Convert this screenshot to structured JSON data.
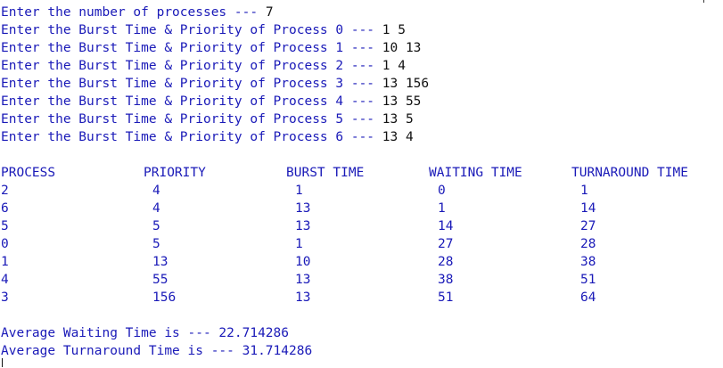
{
  "input_lines": [
    {
      "prompt": "Enter the number of processes --- ",
      "value": "7"
    },
    {
      "prompt": "Enter the Burst Time & Priority of Process 0 --- ",
      "value": "1 5"
    },
    {
      "prompt": "Enter the Burst Time & Priority of Process 1 --- ",
      "value": "10 13"
    },
    {
      "prompt": "Enter the Burst Time & Priority of Process 2 --- ",
      "value": "1 4"
    },
    {
      "prompt": "Enter the Burst Time & Priority of Process 3 --- ",
      "value": "13 156"
    },
    {
      "prompt": "Enter the Burst Time & Priority of Process 4 --- ",
      "value": "13 55"
    },
    {
      "prompt": "Enter the Burst Time & Priority of Process 5 --- ",
      "value": "13 5"
    },
    {
      "prompt": "Enter the Burst Time & Priority of Process 6 --- ",
      "value": "13 4"
    }
  ],
  "table": {
    "headers": [
      "PROCESS",
      "PRIORITY",
      "BURST TIME",
      "WAITING TIME",
      "TURNAROUND TIME"
    ],
    "rows": [
      [
        "2",
        "4",
        "1",
        "0",
        "1"
      ],
      [
        "6",
        "4",
        "13",
        "1",
        "14"
      ],
      [
        "5",
        "5",
        "13",
        "14",
        "27"
      ],
      [
        "0",
        "5",
        "1",
        "27",
        "28"
      ],
      [
        "1",
        "13",
        "10",
        "28",
        "38"
      ],
      [
        "4",
        "55",
        "13",
        "38",
        "51"
      ],
      [
        "3",
        "156",
        "13",
        "51",
        "64"
      ]
    ]
  },
  "averages": {
    "waiting": "Average Waiting Time is --- 22.714286",
    "turnaround": "Average Turnaround Time is --- 31.714286"
  },
  "colors": {
    "output_text": "#1a1ab8",
    "input_text": "#111111",
    "background": "#ffffff"
  }
}
